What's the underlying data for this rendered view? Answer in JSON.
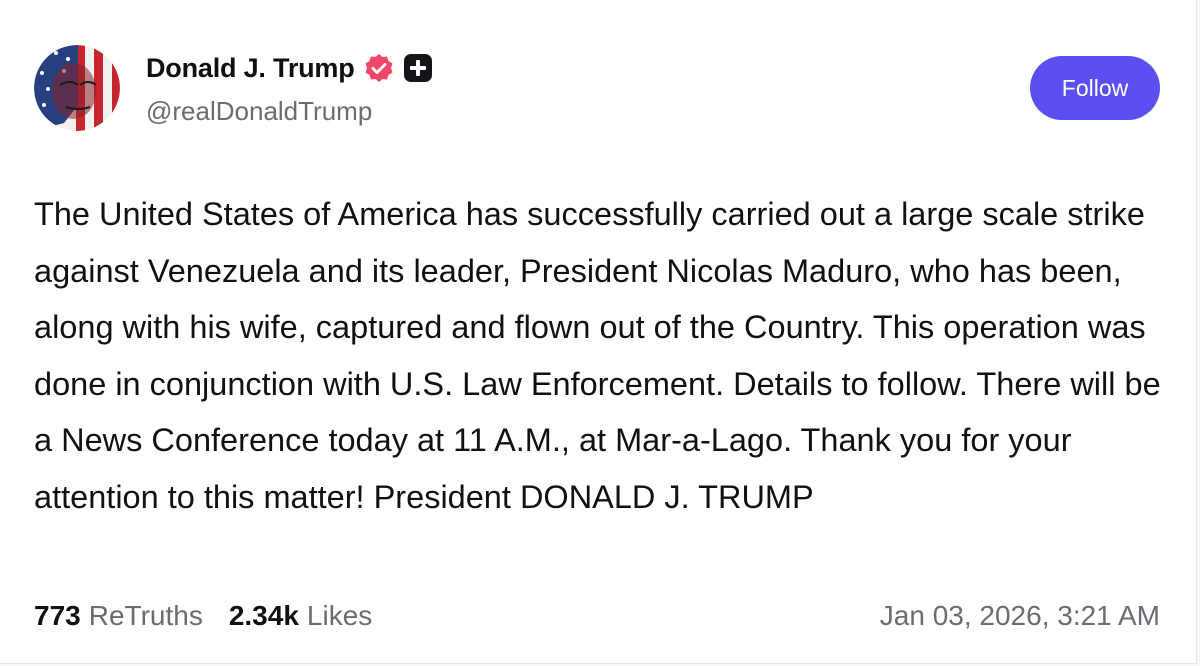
{
  "post": {
    "author": {
      "display_name": "Donald J. Trump",
      "handle": "@realDonaldTrump",
      "verified_icon": "verified-badge-icon",
      "plus_icon": "plus-badge-icon",
      "avatar_icon": "profile-avatar"
    },
    "follow_label": "Follow",
    "text": "The United States of America has successfully carried out a large scale strike against Venezuela and its leader, President Nicolas Maduro, who has been, along with his wife, captured and flown out of the Country. This operation was done in conjunction with U.S. Law Enforcement. Details to follow. There will be a News Conference today at 11 A.M., at Mar-a-Lago. Thank you for your attention to this matter! President DONALD J. TRUMP",
    "stats": {
      "retruths_count": "773",
      "retruths_label": "ReTruths",
      "likes_count": "2.34k",
      "likes_label": "Likes"
    },
    "timestamp": "Jan 03, 2026, 3:21 AM"
  },
  "colors": {
    "accent": "#5c4ff2",
    "verified": "#f0466a",
    "text_primary": "#111114",
    "text_secondary": "#6b6b73"
  }
}
